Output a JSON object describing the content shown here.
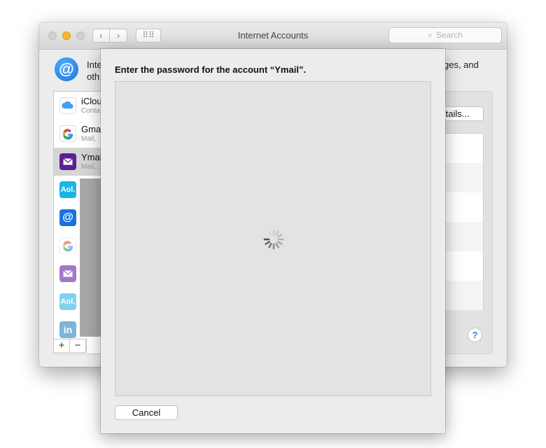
{
  "window": {
    "title": "Internet Accounts",
    "search_placeholder": "Search",
    "intro_left": "Inte",
    "intro_left_line2": "oth",
    "intro_right": "ges, and",
    "details_label": "etails...",
    "help_label": "?"
  },
  "sidebar": {
    "accounts": [
      {
        "name": "iClou",
        "sub": "Conta",
        "icon": "icloud-icon"
      },
      {
        "name": "Gmai",
        "sub": "Mail, .",
        "icon": "google-icon"
      },
      {
        "name": "Ymai",
        "sub": "Mail, .",
        "icon": "mail-icon"
      }
    ],
    "providers": [
      {
        "label": "Aol.",
        "icon": "aol-icon"
      },
      {
        "label": "@",
        "icon": "at-icon"
      },
      {
        "label": "G",
        "icon": "google-icon"
      },
      {
        "label": "",
        "icon": "mail-icon"
      },
      {
        "label": "Aol.",
        "icon": "aol-icon"
      },
      {
        "label": "in",
        "icon": "linkedin-icon"
      }
    ],
    "add_label": "+",
    "remove_label": "−"
  },
  "sheet": {
    "prompt": "Enter the password for the account “Ymail”.",
    "cancel_label": "Cancel"
  },
  "colors": {
    "minimize": "#f5b72c",
    "selected_row": "#d5d5d5",
    "aol_blue": "#19b4e8",
    "ymail_purple": "#5d1f97",
    "accent": "#2b7de9"
  }
}
